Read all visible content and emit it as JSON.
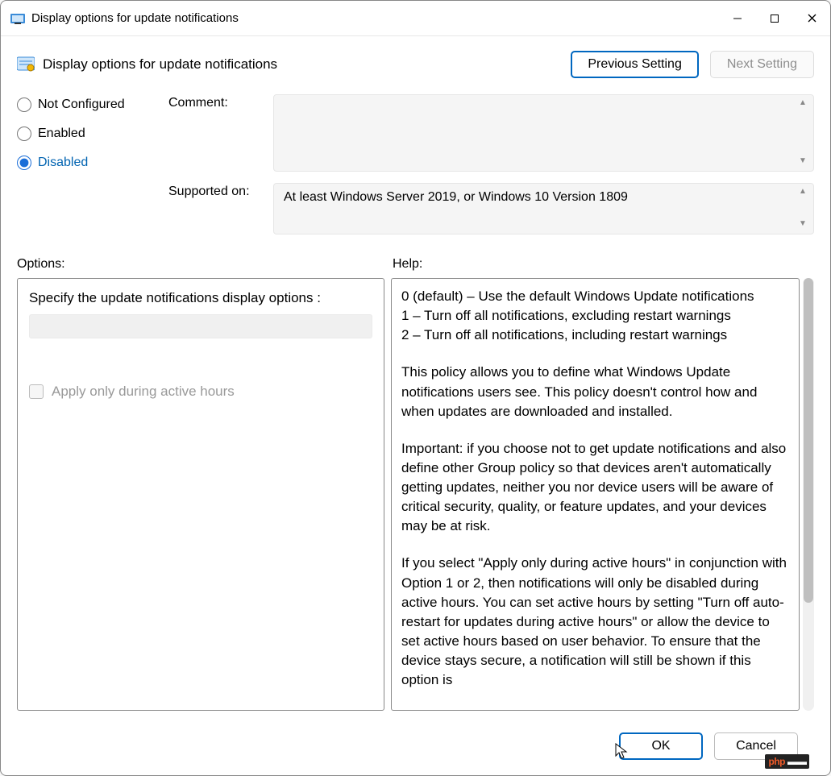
{
  "window": {
    "title": "Display options for update notifications"
  },
  "header": {
    "title": "Display options for update notifications",
    "prev_btn": "Previous Setting",
    "next_btn": "Next Setting"
  },
  "state": {
    "not_configured": "Not Configured",
    "enabled": "Enabled",
    "disabled": "Disabled",
    "selected": "disabled"
  },
  "meta": {
    "comment_label": "Comment:",
    "comment_value": "",
    "supported_label": "Supported on:",
    "supported_value": "At least Windows Server 2019, or Windows 10 Version 1809"
  },
  "labels": {
    "options": "Options:",
    "help": "Help:"
  },
  "options": {
    "specify_label": "Specify the update notifications display options :",
    "checkbox_label": "Apply only during active hours",
    "checkbox_checked": false
  },
  "help": {
    "line1": "0 (default) – Use the default Windows Update notifications",
    "line2": "1 – Turn off all notifications, excluding restart warnings",
    "line3": "2 – Turn off all notifications, including restart warnings",
    "para2": "This policy allows you to define what Windows Update notifications users see. This policy doesn't control how and when updates are downloaded and installed.",
    "para3": "Important: if you choose not to get update notifications and also define other Group policy so that devices aren't automatically getting updates, neither you nor device users will be aware of critical security, quality, or feature updates, and your devices may be at risk.",
    "para4": "If you select \"Apply only during active hours\" in conjunction with Option 1 or 2, then notifications will only be disabled during active hours. You can set active hours by setting \"Turn off auto-restart for updates during active hours\" or allow the device to set active hours based on user behavior. To ensure that the device stays secure, a notification will still be shown if this option is"
  },
  "footer": {
    "ok": "OK",
    "cancel": "Cancel"
  },
  "badge": {
    "p": "php",
    "rest": "▬▬"
  }
}
